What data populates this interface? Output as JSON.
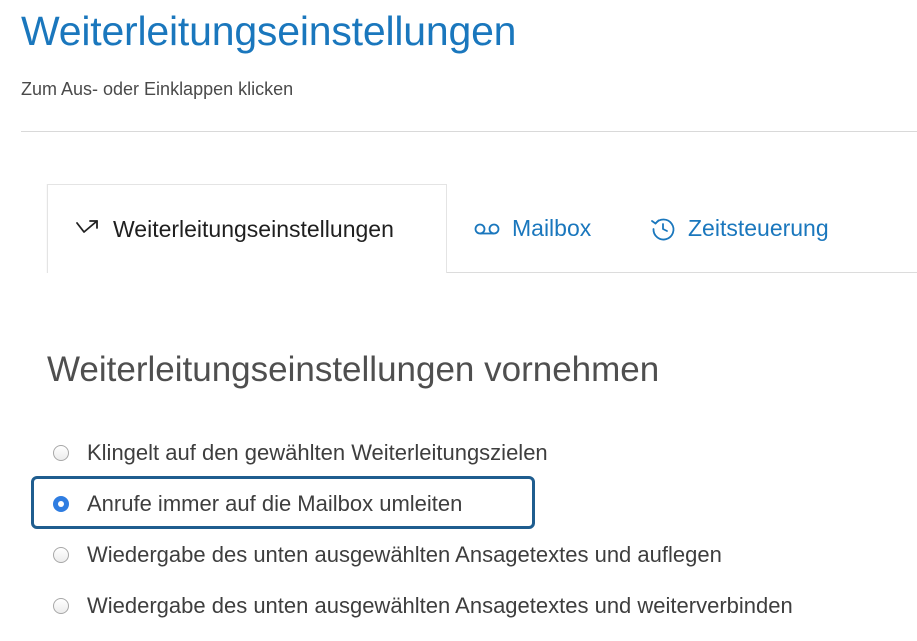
{
  "header": {
    "title": "Weiterleitungseinstellungen",
    "toggle_hint": "Zum Aus- oder Einklappen klicken"
  },
  "tabs": [
    {
      "label": "Weiterleitungseinstellungen",
      "icon": "forward-arrow-icon",
      "active": true
    },
    {
      "label": "Mailbox",
      "icon": "voicemail-icon",
      "active": false
    },
    {
      "label": "Zeitsteuerung",
      "icon": "clock-icon",
      "active": false
    }
  ],
  "section": {
    "title": "Weiterleitungseinstellungen vornehmen",
    "options": [
      {
        "label": "Klingelt auf den gewählten Weiterleitungszielen",
        "checked": false
      },
      {
        "label": "Anrufe immer auf die Mailbox umleiten",
        "checked": true
      },
      {
        "label": "Wiedergabe des unten ausgewählten Ansagetextes und auflegen",
        "checked": false
      },
      {
        "label": "Wiedergabe des unten ausgewählten Ansagetextes und weiterverbinden",
        "checked": false
      }
    ]
  },
  "colors": {
    "accent": "#1a77bd",
    "radio_checked": "#2f7de1",
    "focus_ring": "#1f5d8f"
  }
}
